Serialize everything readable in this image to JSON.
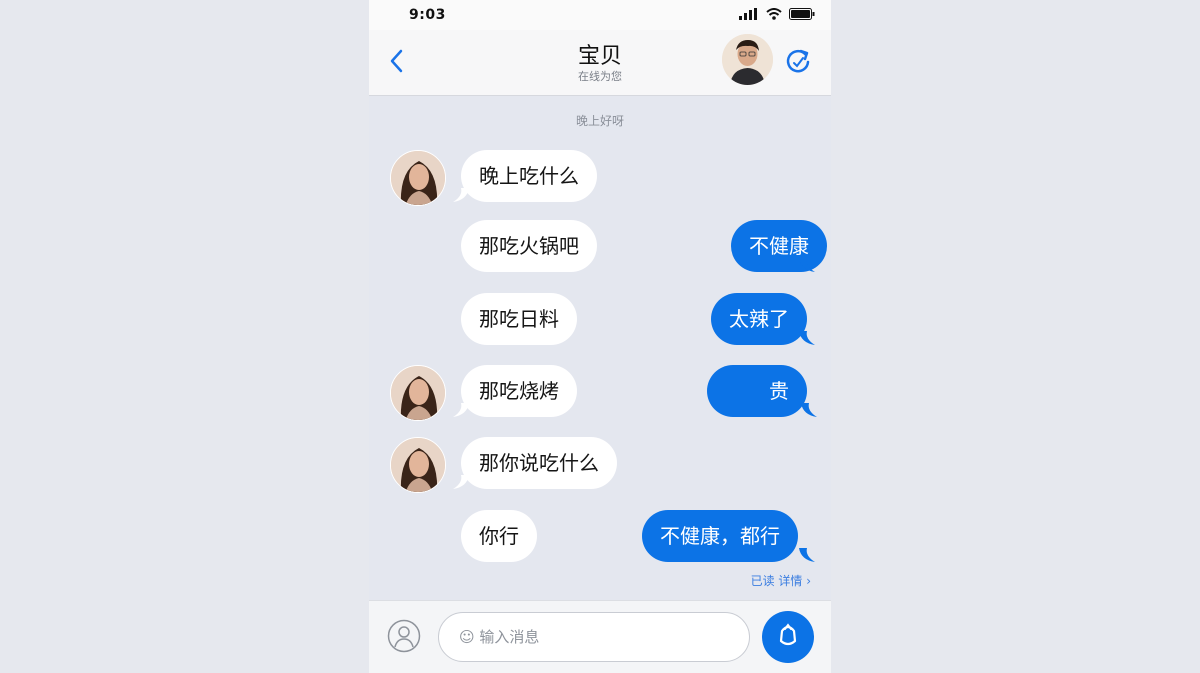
{
  "status": {
    "time": "9:03"
  },
  "header": {
    "title": "宝贝",
    "subtitle": "在线为您"
  },
  "chat": {
    "divider": "晚上好呀",
    "messages": [
      {
        "side": "in",
        "text": "晚上吃什么"
      },
      {
        "side": "in",
        "text": "那吃火锅吧"
      },
      {
        "side": "out",
        "text": "不健康"
      },
      {
        "side": "in",
        "text": "那吃日料"
      },
      {
        "side": "out",
        "text": "太辣了"
      },
      {
        "side": "in",
        "text": "那吃烧烤"
      },
      {
        "side": "out",
        "text": "贵"
      },
      {
        "side": "in",
        "text": "那你说吃什么"
      },
      {
        "side": "in",
        "text": "你行"
      },
      {
        "side": "out",
        "text": "不健康，都行"
      }
    ],
    "read_receipt": "已读 详情 ›"
  },
  "composer": {
    "placeholder": "☺ 输入消息"
  },
  "colors": {
    "accent": "#0c73e6",
    "bubble_in": "#ffffff",
    "background": "#e4e7ef"
  },
  "icons": [
    "back-chevron-icon",
    "refresh-icon",
    "user-icon",
    "send-icon",
    "signal-icon",
    "wifi-icon",
    "battery-icon"
  ]
}
